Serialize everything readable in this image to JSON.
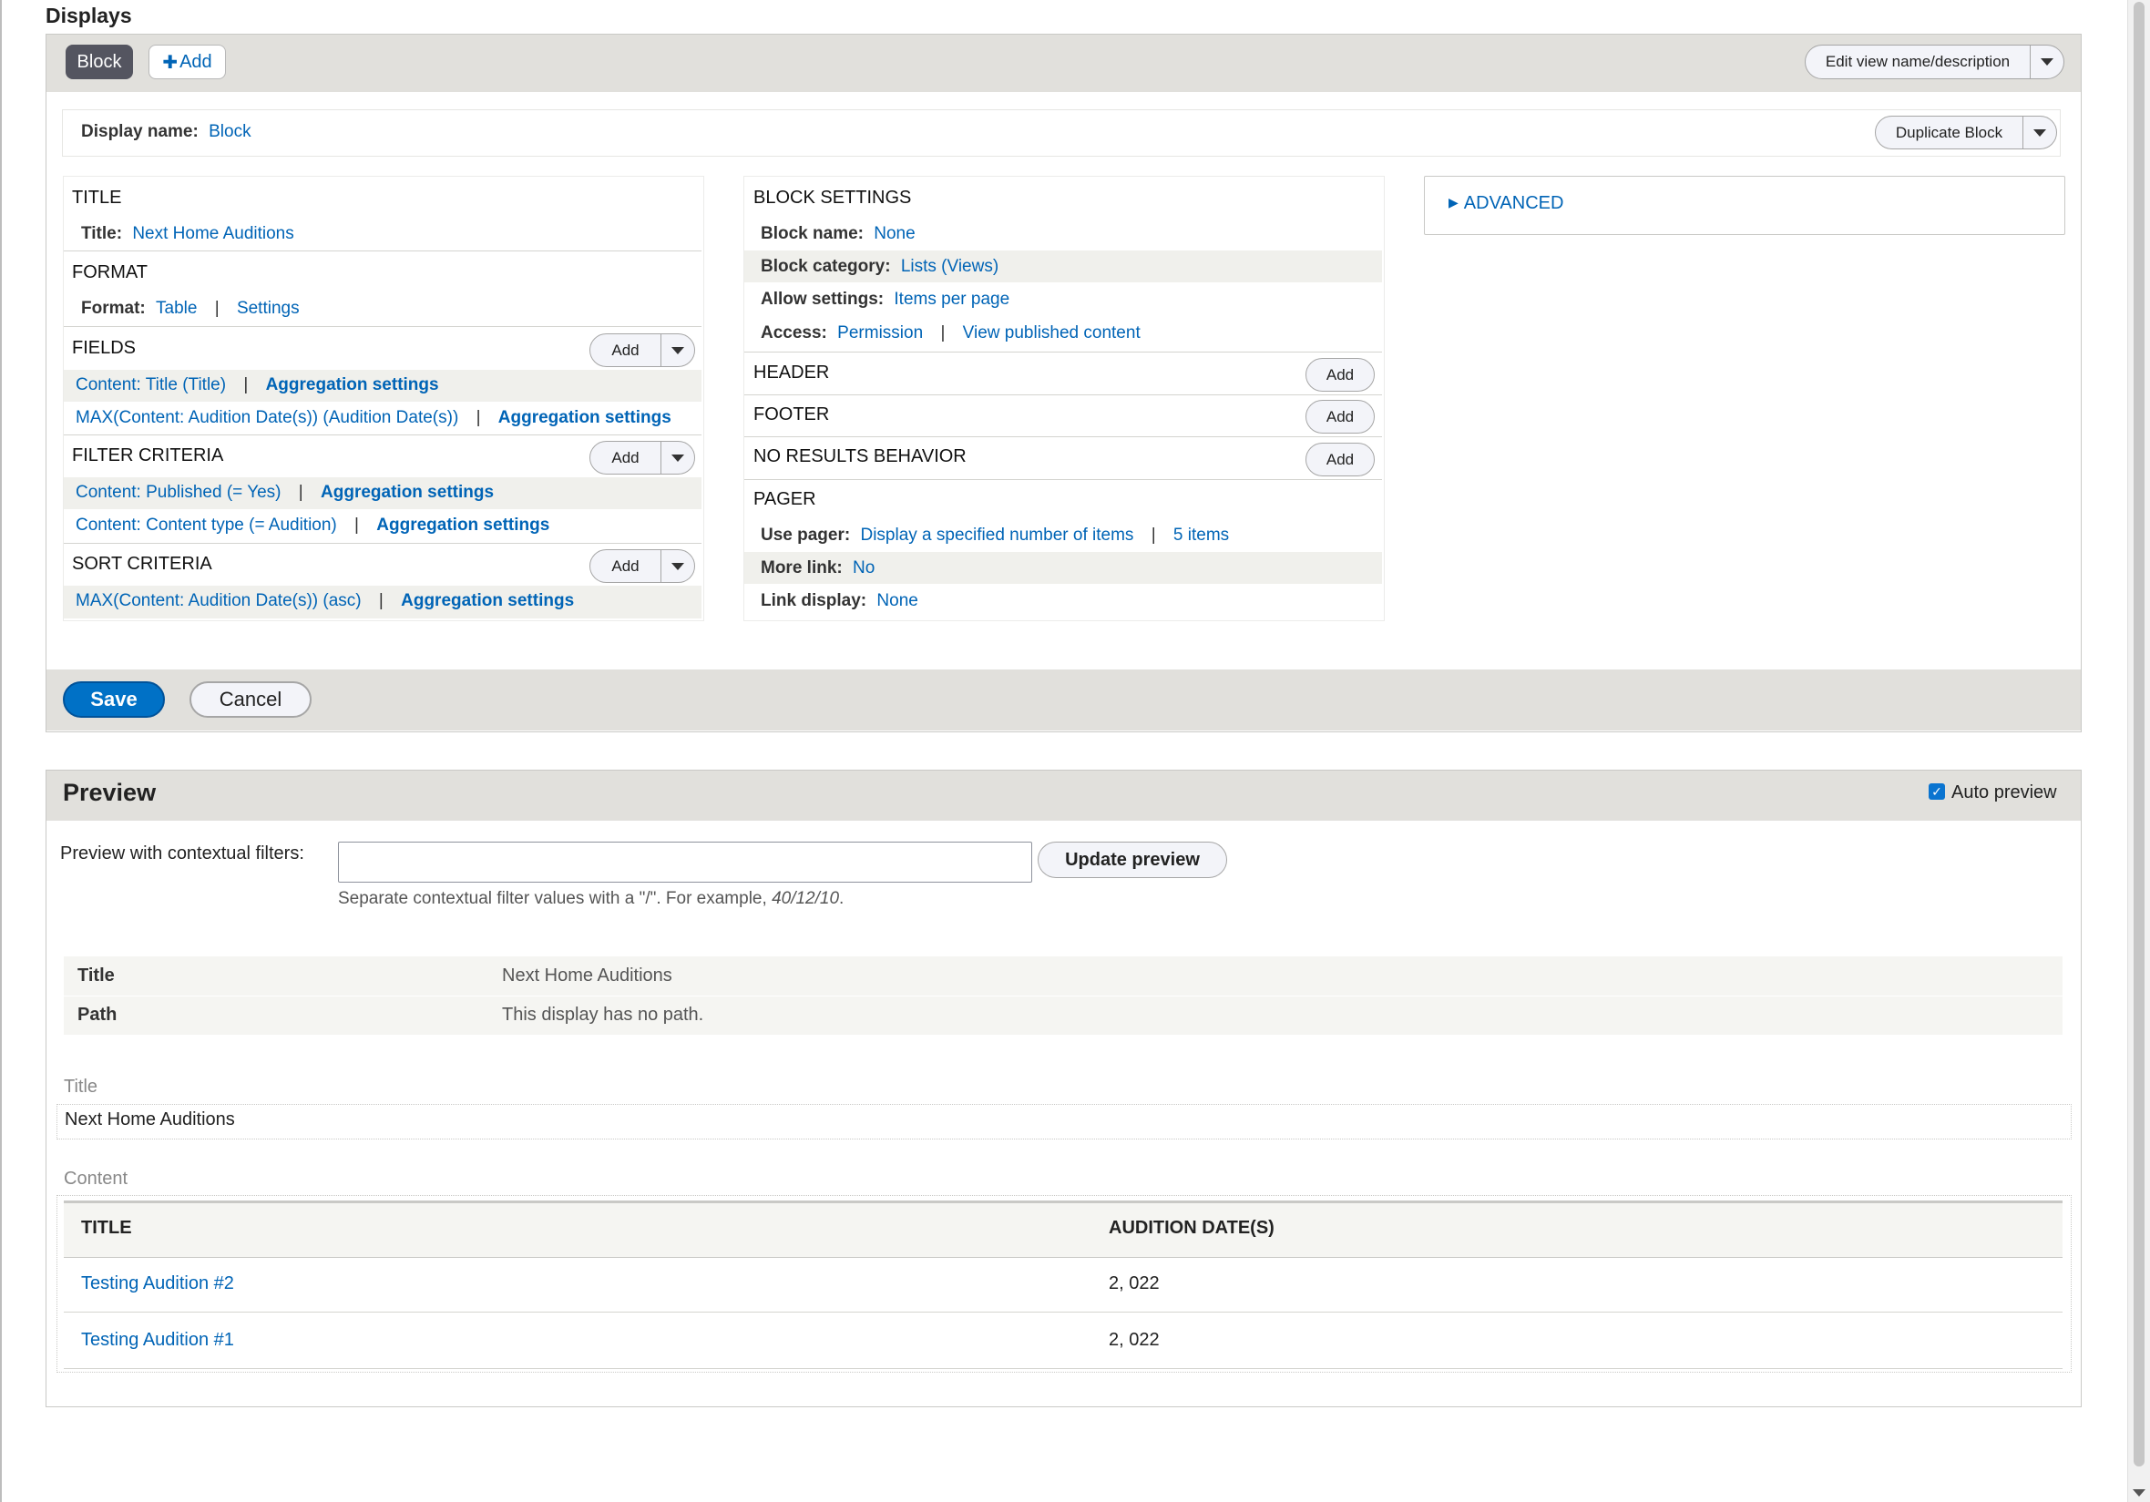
{
  "displays": {
    "heading": "Displays",
    "tabs": {
      "block": "Block",
      "add": "Add"
    },
    "edit_button": "Edit view name/description",
    "display_name_label": "Display name:",
    "display_name_value": "Block",
    "duplicate_button": "Duplicate Block"
  },
  "left_column": {
    "title_section": "TITLE",
    "title_label": "Title:",
    "title_value": "Next Home Auditions",
    "format_section": "FORMAT",
    "format_label": "Format:",
    "format_value": "Table",
    "format_settings": "Settings",
    "fields_section": "FIELDS",
    "fields_add": "Add",
    "fields": [
      {
        "value": "Content: Title (Title)",
        "agg": "Aggregation settings"
      },
      {
        "value": "MAX(Content: Audition Date(s)) (Audition Date(s))",
        "agg": "Aggregation settings"
      }
    ],
    "filter_section": "FILTER CRITERIA",
    "filter_add": "Add",
    "filters": [
      {
        "value": "Content: Published (= Yes)",
        "agg": "Aggregation settings"
      },
      {
        "value": "Content: Content type (= Audition)",
        "agg": "Aggregation settings"
      }
    ],
    "sort_section": "SORT CRITERIA",
    "sort_add": "Add",
    "sorts": [
      {
        "value": "MAX(Content: Audition Date(s)) (asc)",
        "agg": "Aggregation settings"
      }
    ]
  },
  "middle_column": {
    "block_settings_section": "BLOCK SETTINGS",
    "block_name_label": "Block name:",
    "block_name_value": "None",
    "block_category_label": "Block category:",
    "block_category_value": "Lists (Views)",
    "allow_settings_label": "Allow settings:",
    "allow_settings_value": "Items per page",
    "access_label": "Access:",
    "access_value": "Permission",
    "access_value2": "View published content",
    "header_section": "HEADER",
    "header_add": "Add",
    "footer_section": "FOOTER",
    "footer_add": "Add",
    "no_results_section": "NO RESULTS BEHAVIOR",
    "no_results_add": "Add",
    "pager_section": "PAGER",
    "use_pager_label": "Use pager:",
    "use_pager_value": "Display a specified number of items",
    "use_pager_value2": "5 items",
    "more_link_label": "More link:",
    "more_link_value": "No",
    "link_display_label": "Link display:",
    "link_display_value": "None"
  },
  "right_column": {
    "advanced": "ADVANCED"
  },
  "actions": {
    "save": "Save",
    "cancel": "Cancel"
  },
  "preview": {
    "heading": "Preview",
    "auto_preview_label": "Auto preview",
    "auto_preview_checked": true,
    "contextual_label": "Preview with contextual filters:",
    "contextual_value": "",
    "update_button": "Update preview",
    "help_text_pre": "Separate contextual filter values with a \"/\". For example, ",
    "help_text_example": "40/12/10",
    "help_text_post": ".",
    "info_rows": [
      {
        "label": "Title",
        "value": "Next Home Auditions"
      },
      {
        "label": "Path",
        "value": "This display has no path."
      }
    ],
    "title_caption": "Title",
    "title_value": "Next Home Auditions",
    "content_caption": "Content",
    "table": {
      "headers": [
        "TITLE",
        "AUDITION DATE(S)"
      ],
      "rows": [
        {
          "title": "Testing Audition #2",
          "date": "2, 022"
        },
        {
          "title": "Testing Audition #1",
          "date": "2, 022"
        }
      ]
    }
  },
  "colors": {
    "link": "#0064b6",
    "primary_button": "#0071c6",
    "bar": "#e1e0dc"
  }
}
